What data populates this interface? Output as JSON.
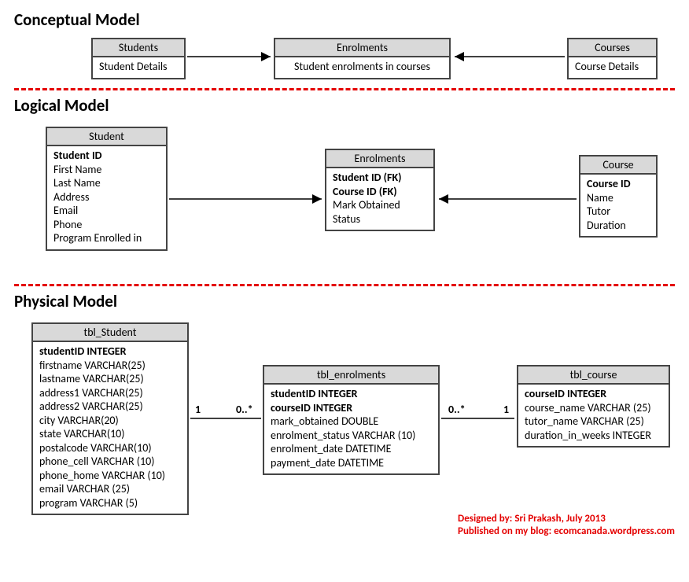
{
  "conceptual": {
    "title": "Conceptual Model",
    "entities": {
      "students": {
        "name": "Students",
        "desc": "Student Details"
      },
      "enrolments": {
        "name": "Enrolments",
        "desc": "Student enrolments in courses"
      },
      "courses": {
        "name": "Courses",
        "desc": "Course Details"
      }
    }
  },
  "logical": {
    "title": "Logical Model",
    "student": {
      "name": "Student",
      "attrs": [
        "Student ID",
        "First Name",
        "Last Name",
        "Address",
        "Email",
        "Phone",
        "Program Enrolled in"
      ],
      "bold": [
        "Student ID"
      ]
    },
    "enrolments": {
      "name": "Enrolments",
      "attrs": [
        "Student ID (FK)",
        "Course ID (FK)",
        "Mark Obtained",
        "Status"
      ],
      "bold": [
        "Student ID (FK)",
        "Course ID (FK)"
      ]
    },
    "course": {
      "name": "Course",
      "attrs": [
        "Course ID",
        "Name",
        "Tutor",
        "Duration"
      ],
      "bold": [
        "Course ID"
      ]
    }
  },
  "physical": {
    "title": "Physical Model",
    "student": {
      "name": "tbl_Student",
      "attrs": [
        "studentID INTEGER",
        "firstname VARCHAR(25)",
        "lastname VARCHAR(25)",
        "address1 VARCHAR(25)",
        "address2 VARCHAR(25)",
        "city VARCHAR(20)",
        "state VARCHAR(10)",
        "postalcode VARCHAR(10)",
        "phone_cell VARCHAR (10)",
        "phone_home VARCHAR (10)",
        "email VARCHAR (25)",
        "program VARCHAR (5)"
      ],
      "bold": [
        "studentID INTEGER"
      ]
    },
    "enrolments": {
      "name": "tbl_enrolments",
      "attrs": [
        "studentID INTEGER",
        "courseID INTEGER",
        "mark_obtained DOUBLE",
        "enrolment_status VARCHAR (10)",
        "enrolment_date DATETIME",
        "payment_date DATETIME"
      ],
      "bold": [
        "studentID INTEGER",
        "courseID INTEGER"
      ]
    },
    "course": {
      "name": "tbl_course",
      "attrs": [
        "courseID INTEGER",
        "course_name VARCHAR (25)",
        "tutor_name VARCHAR (25)",
        "duration_in_weeks INTEGER"
      ],
      "bold": [
        "courseID INTEGER"
      ]
    },
    "cardinality": {
      "s_e_left": "1",
      "s_e_right": "0..*",
      "e_c_left": "0..*",
      "e_c_right": "1"
    }
  },
  "credit": {
    "line1": "Designed by: Sri Prakash, July 2013",
    "line2": "Published on my blog: ecomcanada.wordpress.com"
  }
}
